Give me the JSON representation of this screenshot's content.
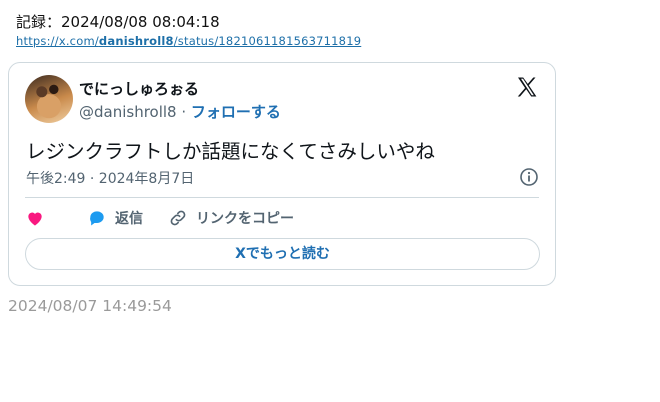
{
  "record": {
    "label": "記録：",
    "datetime": "2024/08/08 08:04:18"
  },
  "url": {
    "prefix": "https://x.com/",
    "user": "danishroll8",
    "suffix": "/status/1821061181563711819"
  },
  "tweet": {
    "display_name": "でにっしゅろぉる",
    "handle": "@danishroll8",
    "separator": " · ",
    "follow_label": "フォローする",
    "text": "レジンクラフトしか話題になくてさみしいやね",
    "timestamp": "午後2:49 · 2024年8月7日",
    "reply_label": "返信",
    "copy_link_label": "リンクをコピー",
    "read_more_label": "Xでもっと読む"
  },
  "footer": {
    "date": "2024/08/07 14:49:54"
  },
  "colors": {
    "like": "#f91880",
    "reply": "#1d9bf0",
    "link": "#1f6fb2",
    "muted": "#536471"
  },
  "icons": [
    "x-logo-icon",
    "info-icon",
    "heart-icon",
    "reply-bubble-icon",
    "link-icon"
  ]
}
